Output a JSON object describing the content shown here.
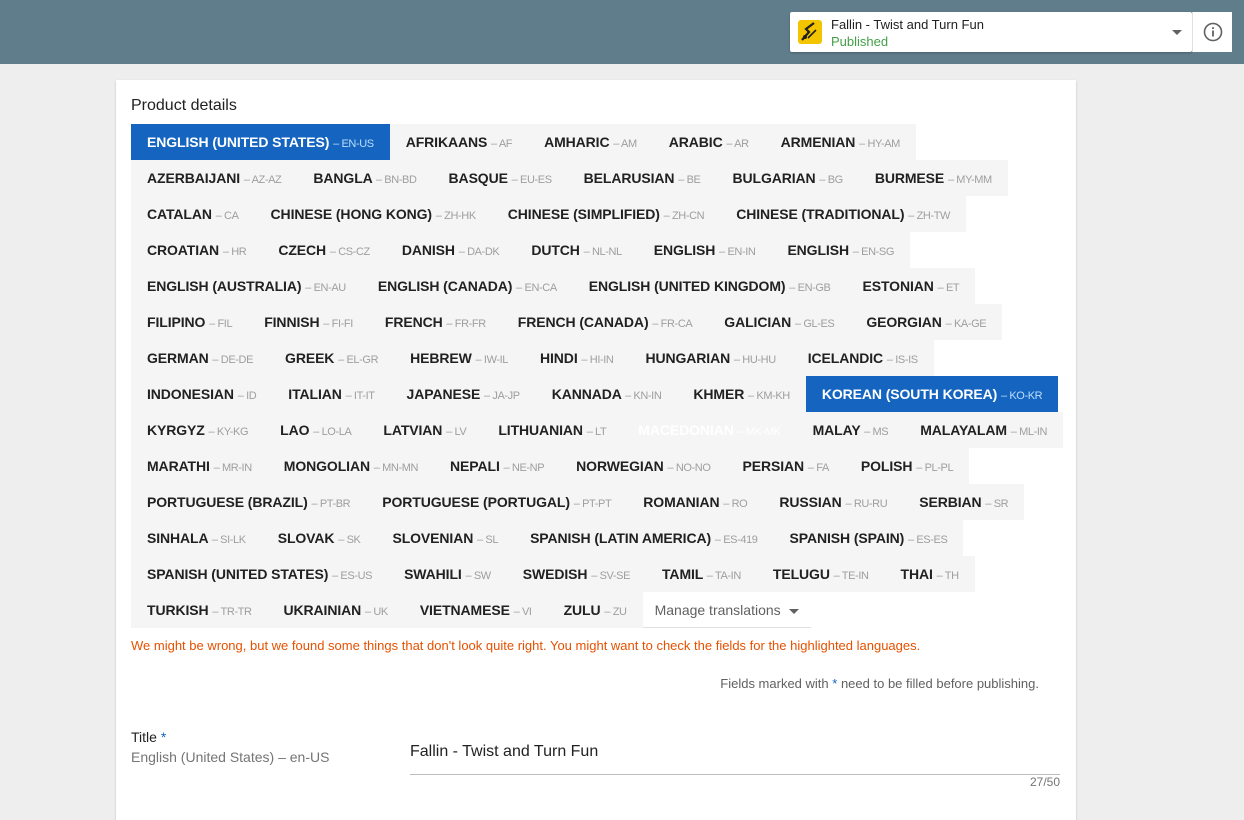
{
  "app": {
    "name": "Fallin - Twist and Turn Fun",
    "status": "Published",
    "icon": "app-icon",
    "status_color": "#43a047"
  },
  "product_details": {
    "heading": "Product details",
    "languages": [
      {
        "name": "ENGLISH (UNITED STATES)",
        "code": "– en-US",
        "selected": true
      },
      {
        "name": "AFRIKAANS",
        "code": "– af"
      },
      {
        "name": "AMHARIC",
        "code": "– am"
      },
      {
        "name": "ARABIC",
        "code": "– ar"
      },
      {
        "name": "ARMENIAN",
        "code": "– hy-AM"
      },
      {
        "name": "AZERBAIJANI",
        "code": "– az-AZ"
      },
      {
        "name": "BANGLA",
        "code": "– bn-BD"
      },
      {
        "name": "BASQUE",
        "code": "– eu-ES"
      },
      {
        "name": "BELARUSIAN",
        "code": "– be"
      },
      {
        "name": "BULGARIAN",
        "code": "– bg"
      },
      {
        "name": "BURMESE",
        "code": "– my-MM"
      },
      {
        "name": "CATALAN",
        "code": "– ca"
      },
      {
        "name": "CHINESE (HONG KONG)",
        "code": "– zh-HK"
      },
      {
        "name": "CHINESE (SIMPLIFIED)",
        "code": "– zh-CN"
      },
      {
        "name": "CHINESE (TRADITIONAL)",
        "code": "– zh-TW"
      },
      {
        "name": "CROATIAN",
        "code": "– hr"
      },
      {
        "name": "CZECH",
        "code": "– cs-CZ"
      },
      {
        "name": "DANISH",
        "code": "– da-DK"
      },
      {
        "name": "DUTCH",
        "code": "– nl-NL"
      },
      {
        "name": "ENGLISH",
        "code": "– en-IN"
      },
      {
        "name": "ENGLISH",
        "code": "– en-SG"
      },
      {
        "name": "ENGLISH (AUSTRALIA)",
        "code": "– en-AU"
      },
      {
        "name": "ENGLISH (CANADA)",
        "code": "– en-CA"
      },
      {
        "name": "ENGLISH (UNITED KINGDOM)",
        "code": "– en-GB"
      },
      {
        "name": "ESTONIAN",
        "code": "– et"
      },
      {
        "name": "FILIPINO",
        "code": "– fil"
      },
      {
        "name": "FINNISH",
        "code": "– fi-FI"
      },
      {
        "name": "FRENCH",
        "code": "– fr-FR"
      },
      {
        "name": "FRENCH (CANADA)",
        "code": "– fr-CA"
      },
      {
        "name": "GALICIAN",
        "code": "– gl-ES"
      },
      {
        "name": "GEORGIAN",
        "code": "– ka-GE"
      },
      {
        "name": "GERMAN",
        "code": "– de-DE"
      },
      {
        "name": "GREEK",
        "code": "– el-GR"
      },
      {
        "name": "HEBREW",
        "code": "– iw-IL"
      },
      {
        "name": "HINDI",
        "code": "– hi-IN"
      },
      {
        "name": "HUNGARIAN",
        "code": "– hu-HU"
      },
      {
        "name": "ICELANDIC",
        "code": "– is-IS"
      },
      {
        "name": "INDONESIAN",
        "code": "– id"
      },
      {
        "name": "ITALIAN",
        "code": "– it-IT"
      },
      {
        "name": "JAPANESE",
        "code": "– ja-JP"
      },
      {
        "name": "KANNADA",
        "code": "– kn-IN"
      },
      {
        "name": "KHMER",
        "code": "– km-KH"
      },
      {
        "name": "KOREAN (SOUTH KOREA)",
        "code": "– ko-KR",
        "selected": true
      },
      {
        "name": "KYRGYZ",
        "code": "– ky-KG"
      },
      {
        "name": "LAO",
        "code": "– lo-LA"
      },
      {
        "name": "LATVIAN",
        "code": "– lv"
      },
      {
        "name": "LITHUANIAN",
        "code": "– lt"
      },
      {
        "name": "MACEDONIAN",
        "code": "– mk-MK",
        "ghost": true
      },
      {
        "name": "MALAY",
        "code": "– ms"
      },
      {
        "name": "MALAYALAM",
        "code": "– ml-IN"
      },
      {
        "name": "MARATHI",
        "code": "– mr-IN"
      },
      {
        "name": "MONGOLIAN",
        "code": "– mn-MN"
      },
      {
        "name": "NEPALI",
        "code": "– ne-NP"
      },
      {
        "name": "NORWEGIAN",
        "code": "– no-NO"
      },
      {
        "name": "PERSIAN",
        "code": "– fa"
      },
      {
        "name": "POLISH",
        "code": "– pl-PL"
      },
      {
        "name": "PORTUGUESE (BRAZIL)",
        "code": "– pt-BR"
      },
      {
        "name": "PORTUGUESE (PORTUGAL)",
        "code": "– pt-PT"
      },
      {
        "name": "ROMANIAN",
        "code": "– ro"
      },
      {
        "name": "RUSSIAN",
        "code": "– ru-RU"
      },
      {
        "name": "SERBIAN",
        "code": "– sr"
      },
      {
        "name": "SINHALA",
        "code": "– si-LK"
      },
      {
        "name": "SLOVAK",
        "code": "– sk"
      },
      {
        "name": "SLOVENIAN",
        "code": "– sl"
      },
      {
        "name": "SPANISH (LATIN AMERICA)",
        "code": "– es-419"
      },
      {
        "name": "SPANISH (SPAIN)",
        "code": "– es-ES"
      },
      {
        "name": "SPANISH (UNITED STATES)",
        "code": "– es-US"
      },
      {
        "name": "SWAHILI",
        "code": "– sw"
      },
      {
        "name": "SWEDISH",
        "code": "– sv-SE"
      },
      {
        "name": "TAMIL",
        "code": "– ta-IN"
      },
      {
        "name": "TELUGU",
        "code": "– te-IN"
      },
      {
        "name": "THAI",
        "code": "– th"
      },
      {
        "name": "TURKISH",
        "code": "– tr-TR"
      },
      {
        "name": "UKRAINIAN",
        "code": "– uk"
      },
      {
        "name": "VIETNAMESE",
        "code": "– vi"
      },
      {
        "name": "ZULU",
        "code": "– zu"
      }
    ],
    "manage_translations": "Manage translations",
    "warning": "We might be wrong, but we found some things that don't look quite right. You might want to check the fields for the highlighted languages.",
    "required_note_before": "Fields marked with",
    "required_star": "*",
    "required_note_after": "need to be filled before publishing."
  },
  "title_field": {
    "label": "Title",
    "required_star": "*",
    "language": "English (United States) – en-US",
    "value": "Fallin - Twist and Turn Fun",
    "counter": "27/50"
  },
  "colors": {
    "topbar": "#607d8b",
    "accent": "#1565c0",
    "warning": "#e65100"
  }
}
